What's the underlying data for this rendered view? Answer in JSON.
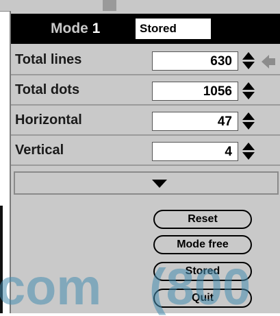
{
  "mode": {
    "label": "Mode",
    "number": "1",
    "status": "Stored"
  },
  "rows": [
    {
      "label": "Total lines",
      "value": "630"
    },
    {
      "label": "Total dots",
      "value": "1056"
    },
    {
      "label": "Horizontal",
      "value": "47"
    },
    {
      "label": "Vertical",
      "value": "4"
    }
  ],
  "buttons": {
    "reset": "Reset",
    "mode_free": "Mode free",
    "stored": "Stored",
    "quit": "Quit"
  },
  "watermark": {
    "left": "com",
    "right": "(800"
  },
  "icons": {
    "back": "back-arrow-icon",
    "stepper": "updown-stepper-icon",
    "expand": "expand-down-icon"
  },
  "colors": {
    "panel": "#c9c9c9",
    "mode_bar": "#000000",
    "watermark": "#468caf"
  }
}
